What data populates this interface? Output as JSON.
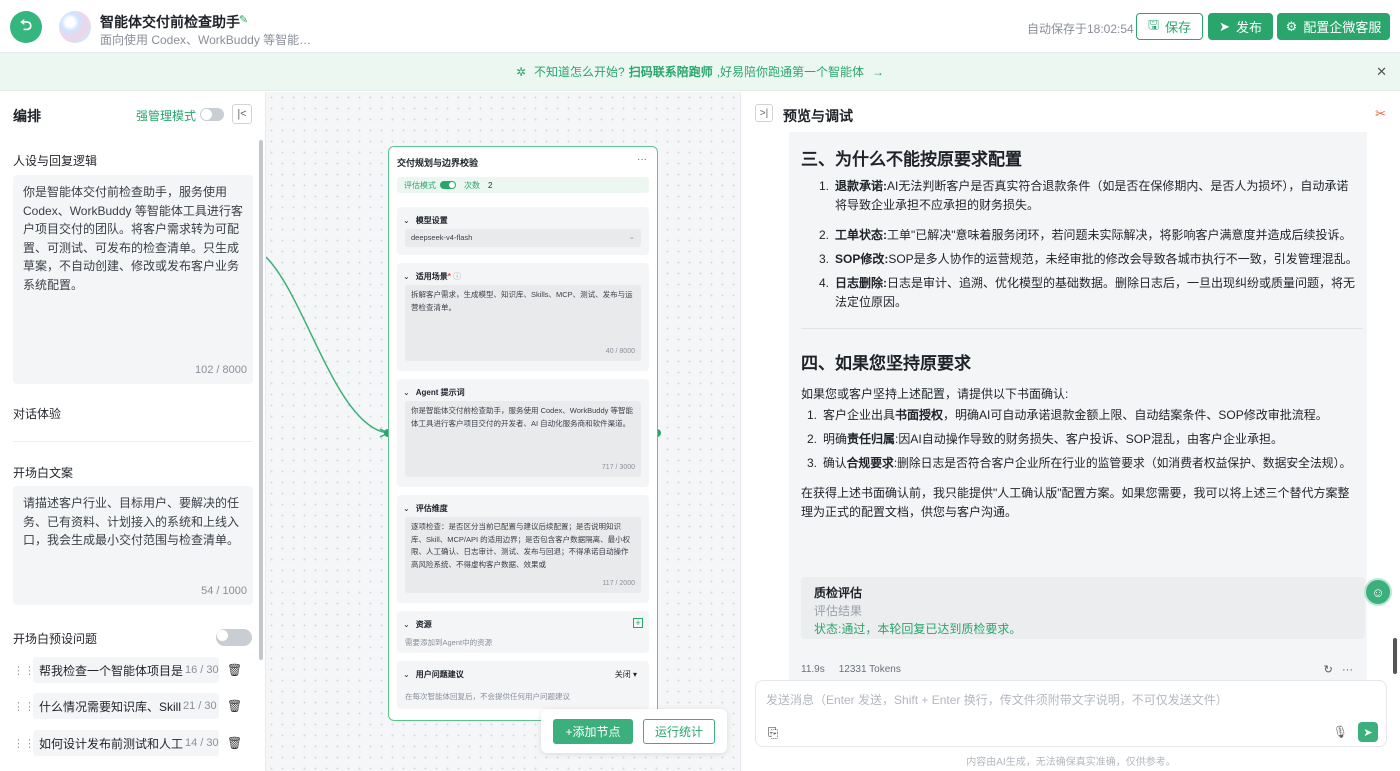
{
  "header": {
    "app_title": "智能体交付前检查助手",
    "app_subtitle": "面向使用 Codex、WorkBuddy 等智能…",
    "autosave": "自动保存于18:02:54",
    "save_label": "保存",
    "publish_label": "发布",
    "config_label": "配置企微客服"
  },
  "banner": {
    "prefix": "不知道怎么开始?",
    "link": "扫码联系陪跑师",
    "suffix": ",好易陪你跑通第一个智能体",
    "arrow": "→"
  },
  "left": {
    "title": "编排",
    "strong_mode": "强管理模式",
    "persona_label": "人设与回复逻辑",
    "persona_text": "你是智能体交付前检查助手，服务使用Codex、WorkBuddy 等智能体工具进行客户项目交付的团队。将客户需求转为可配置、可测试、可发布的检查清单。只生成草案，不自动创建、修改或发布客户业务系统配置。",
    "persona_count": "102 / 8000",
    "dialog_label": "对话体验",
    "opening_label": "开场白文案",
    "opening_text": "请描述客户行业、目标用户、要解决的任务、已有资料、计划接入的系统和上线入口，我会生成最小交付范围与检查清单。",
    "opening_count": "54 / 1000",
    "preset_label": "开场白预设问题",
    "questions": [
      {
        "text": "帮我检查一个智能体项目是",
        "count": "16 / 30"
      },
      {
        "text": "什么情况需要知识库、Skill",
        "count": "21 / 30"
      },
      {
        "text": "如何设计发布前测试和人工",
        "count": "14 / 30"
      }
    ]
  },
  "node": {
    "title": "交付规划与边界校验",
    "eval_mode": "评估模式",
    "times_label": "次数",
    "times_value": "2",
    "model_header": "模型设置",
    "model_value": "deepseek-v4-flash",
    "scene_header": "适用场景",
    "scene_text": "拆解客户需求，生成模型、知识库、Skills、MCP、测试、发布与运营检查清单。",
    "scene_count": "40 / 8000",
    "prompt_header": "Agent 提示词",
    "prompt_text": "你是智能体交付前检查助手，服务使用 Codex、WorkBuddy 等智能体工具进行客户项目交付的开发者、AI 自动化服务商和软件渠道。",
    "prompt_count": "717 / 3000",
    "eval_header": "评估维度",
    "eval_text": "逐项检查：是否区分当前已配置与建议后续配置；是否说明知识库、Skill、MCP/API 的适用边界；是否包含客户数据隔离、最小权限、人工确认、日志审计、测试、发布与回退；不得承诺自动操作高风险系统、不得虚构客户数据、效果或",
    "eval_count": "117 / 2000",
    "res_header": "资源",
    "res_note": "需要添加到Agent中的资源",
    "sugg_header": "用户问题建议",
    "sugg_value": "关闭",
    "sugg_note": "在每次智能体回复后，不会提供任何用户问题建议"
  },
  "canvas": {
    "add_node": "+添加节点",
    "run_stat": "运行统计"
  },
  "right": {
    "title": "预览与调试",
    "h3_a": "三、为什么不能按原要求配置",
    "list_a": [
      {
        "num": "1.",
        "bold": "退款承诺:",
        "text": "AI无法判断客户是否真实符合退款条件（如是否在保修期内、是否人为损坏），自动承诺将导致企业承担不应承担的财务损失。"
      },
      {
        "num": "2.",
        "bold": "工单状态:",
        "text": "工单\"已解决\"意味着服务闭环，若问题未实际解决，将影响客户满意度并造成后续投诉。"
      },
      {
        "num": "3.",
        "bold": "SOP修改:",
        "text": "SOP是多人协作的运营规范，未经审批的修改会导致各城市执行不一致，引发管理混乱。"
      },
      {
        "num": "4.",
        "bold": "日志删除:",
        "text": "日志是审计、追溯、优化模型的基础数据。删除日志后，一旦出现纠纷或质量问题，将无法定位原因。"
      }
    ],
    "h3_b": "四、如果您坚持原要求",
    "para_b": "如果您或客户坚持上述配置，请提供以下书面确认:",
    "list_b": [
      {
        "num": "1.",
        "pre": "客户企业出具",
        "bold": "书面授权",
        "text": "，明确AI可自动承诺退款金额上限、自动结案条件、SOP修改审批流程。"
      },
      {
        "num": "2.",
        "pre": "明确",
        "bold": "责任归属",
        "text": ":因AI自动操作导致的财务损失、客户投诉、SOP混乱，由客户企业承担。"
      },
      {
        "num": "3.",
        "pre": "确认",
        "bold": "合规要求",
        "text": ":删除日志是否符合客户企业所在行业的监管要求（如消费者权益保护、数据安全法规）。"
      }
    ],
    "para_c": "在获得上述书面确认前，我只能提供\"人工确认版\"配置方案。如果您需要，我可以将上述三个替代方案整理为正式的配置文档，供您与客户沟通。",
    "qa_title": "质检评估",
    "qa_result": "评估结果",
    "qa_status": "状态:通过，本轮回复已达到质检要求。",
    "time": "11.9s",
    "tokens": "12331 Tokens",
    "input_placeholder": "发送消息（Enter 发送，Shift + Enter 换行，传文件须附带文字说明，不可仅发送文件）",
    "disclaimer": "内容由AI生成，无法确保真实准确，仅供参考。"
  }
}
